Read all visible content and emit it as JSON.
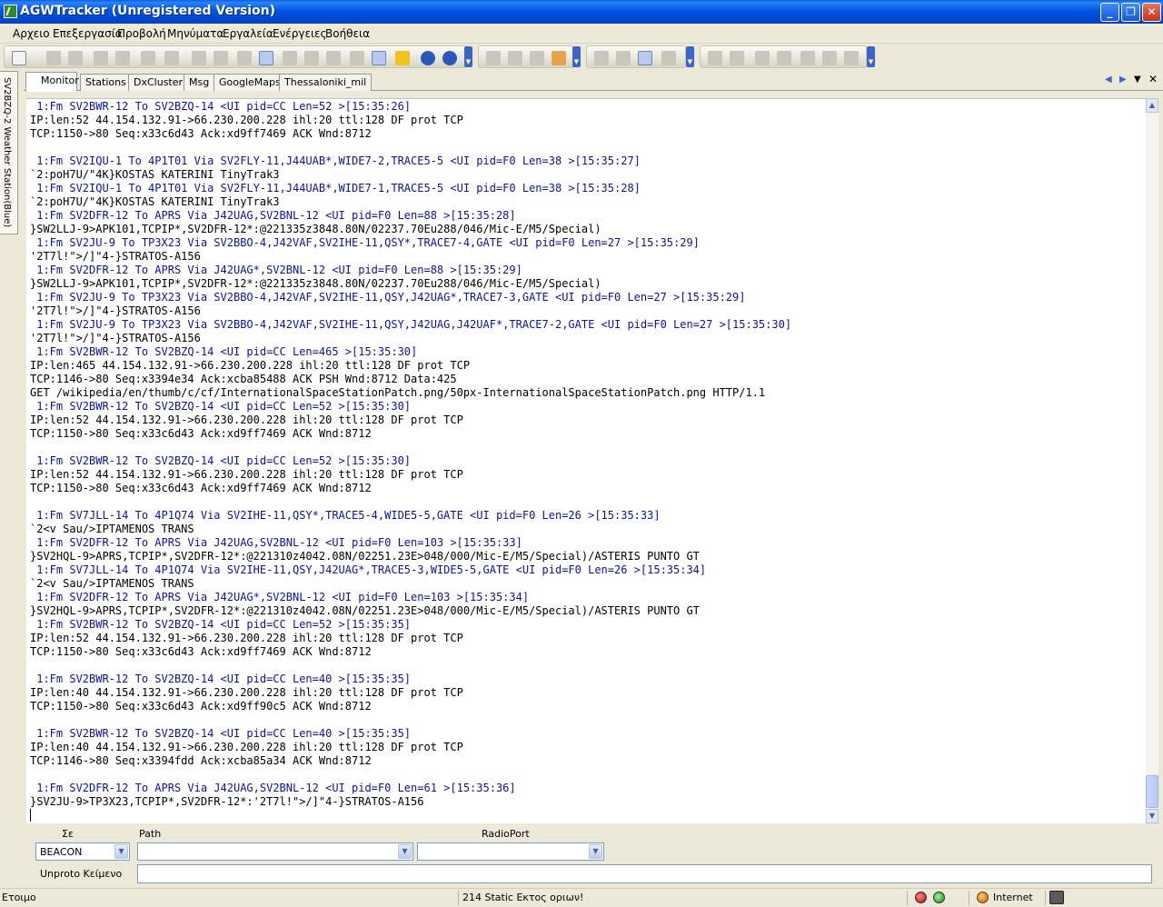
{
  "window": {
    "title": "AGWTracker (Unregistered Version)",
    "min_symbol": "_",
    "max_symbol": "❐",
    "close_symbol": "✕"
  },
  "menu": [
    "Αρχειο",
    "Επεξεργασία",
    "Προβολή",
    "Μηνύματα",
    "Εργαλεία",
    "Ενέργειες",
    "Βοήθεια"
  ],
  "side_tab": {
    "label": "SV2BZQ-2 Weather Station(Blue)"
  },
  "tabs": [
    "Monitor",
    "Stations",
    "DxCluster",
    "Msg",
    "GoogleMaps",
    "Thessaloniki_mil"
  ],
  "active_tab": "Monitor",
  "monitor_lines": [
    {
      "c": "blue",
      "t": " 1:Fm SV2BWR-12 To SV2BZQ-14 <UI pid=CC Len=52 >[15:35:26]"
    },
    {
      "c": "black",
      "t": "IP:len:52 44.154.132.91->66.230.200.228 ihl:20 ttl:128 DF prot TCP"
    },
    {
      "c": "black",
      "t": "TCP:1150->80 Seq:x33c6d43 Ack:xd9ff7469 ACK Wnd:8712"
    },
    {
      "c": "black",
      "t": ""
    },
    {
      "c": "blue",
      "t": " 1:Fm SV2IQU-1 To 4P1T01 Via SV2FLY-11,J44UAB*,WIDE7-2,TRACE5-5 <UI pid=F0 Len=38 >[15:35:27]"
    },
    {
      "c": "black",
      "t": "`2:poH7U/\"4K}KOSTAS KATERINI TinyTrak3"
    },
    {
      "c": "blue",
      "t": " 1:Fm SV2IQU-1 To 4P1T01 Via SV2FLY-11,J44UAB*,WIDE7-1,TRACE5-5 <UI pid=F0 Len=38 >[15:35:28]"
    },
    {
      "c": "black",
      "t": "`2:poH7U/\"4K}KOSTAS KATERINI TinyTrak3"
    },
    {
      "c": "blue",
      "t": " 1:Fm SV2DFR-12 To APRS Via J42UAG,SV2BNL-12 <UI pid=F0 Len=88 >[15:35:28]"
    },
    {
      "c": "black",
      "t": "}SW2LLJ-9>APK101,TCPIP*,SV2DFR-12*:@221335z3848.80N/02237.70Eu288/046/Mic-E/M5/Special)"
    },
    {
      "c": "blue",
      "t": " 1:Fm SV2JU-9 To TP3X23 Via SV2BBO-4,J42VAF,SV2IHE-11,QSY*,TRACE7-4,GATE <UI pid=F0 Len=27 >[15:35:29]"
    },
    {
      "c": "black",
      "t": "'2T7l!\">/]\"4-}STRATOS-A156"
    },
    {
      "c": "blue",
      "t": " 1:Fm SV2DFR-12 To APRS Via J42UAG*,SV2BNL-12 <UI pid=F0 Len=88 >[15:35:29]"
    },
    {
      "c": "black",
      "t": "}SW2LLJ-9>APK101,TCPIP*,SV2DFR-12*:@221335z3848.80N/02237.70Eu288/046/Mic-E/M5/Special)"
    },
    {
      "c": "blue",
      "t": " 1:Fm SV2JU-9 To TP3X23 Via SV2BBO-4,J42VAF,SV2IHE-11,QSY,J42UAG*,TRACE7-3,GATE <UI pid=F0 Len=27 >[15:35:29]"
    },
    {
      "c": "black",
      "t": "'2T7l!\">/]\"4-}STRATOS-A156"
    },
    {
      "c": "blue",
      "t": " 1:Fm SV2JU-9 To TP3X23 Via SV2BBO-4,J42VAF,SV2IHE-11,QSY,J42UAG,J42UAF*,TRACE7-2,GATE <UI pid=F0 Len=27 >[15:35:30]"
    },
    {
      "c": "black",
      "t": "'2T7l!\">/]\"4-}STRATOS-A156"
    },
    {
      "c": "blue",
      "t": " 1:Fm SV2BWR-12 To SV2BZQ-14 <UI pid=CC Len=465 >[15:35:30]"
    },
    {
      "c": "black",
      "t": "IP:len:465 44.154.132.91->66.230.200.228 ihl:20 ttl:128 DF prot TCP"
    },
    {
      "c": "black",
      "t": "TCP:1146->80 Seq:x3394e34 Ack:xcba85488 ACK PSH Wnd:8712 Data:425"
    },
    {
      "c": "black",
      "t": "GET /wikipedia/en/thumb/c/cf/InternationalSpaceStationPatch.png/50px-InternationalSpaceStationPatch.png HTTP/1.1"
    },
    {
      "c": "blue",
      "t": " 1:Fm SV2BWR-12 To SV2BZQ-14 <UI pid=CC Len=52 >[15:35:30]"
    },
    {
      "c": "black",
      "t": "IP:len:52 44.154.132.91->66.230.200.228 ihl:20 ttl:128 DF prot TCP"
    },
    {
      "c": "black",
      "t": "TCP:1150->80 Seq:x33c6d43 Ack:xd9ff7469 ACK Wnd:8712"
    },
    {
      "c": "black",
      "t": ""
    },
    {
      "c": "blue",
      "t": " 1:Fm SV2BWR-12 To SV2BZQ-14 <UI pid=CC Len=52 >[15:35:30]"
    },
    {
      "c": "black",
      "t": "IP:len:52 44.154.132.91->66.230.200.228 ihl:20 ttl:128 DF prot TCP"
    },
    {
      "c": "black",
      "t": "TCP:1150->80 Seq:x33c6d43 Ack:xd9ff7469 ACK Wnd:8712"
    },
    {
      "c": "black",
      "t": ""
    },
    {
      "c": "blue",
      "t": " 1:Fm SV7JLL-14 To 4P1Q74 Via SV2IHE-11,QSY*,TRACE5-4,WIDE5-5,GATE <UI pid=F0 Len=26 >[15:35:33]"
    },
    {
      "c": "black",
      "t": "`2<v Sau/>IPTAMENOS TRANS"
    },
    {
      "c": "blue",
      "t": " 1:Fm SV2DFR-12 To APRS Via J42UAG,SV2BNL-12 <UI pid=F0 Len=103 >[15:35:33]"
    },
    {
      "c": "black",
      "t": "}SV2HQL-9>APRS,TCPIP*,SV2DFR-12*:@221310z4042.08N/02251.23E>048/000/Mic-E/M5/Special)/ASTERIS PUNTO GT"
    },
    {
      "c": "blue",
      "t": " 1:Fm SV7JLL-14 To 4P1Q74 Via SV2IHE-11,QSY,J42UAG*,TRACE5-3,WIDE5-5,GATE <UI pid=F0 Len=26 >[15:35:34]"
    },
    {
      "c": "black",
      "t": "`2<v Sau/>IPTAMENOS TRANS"
    },
    {
      "c": "blue",
      "t": " 1:Fm SV2DFR-12 To APRS Via J42UAG*,SV2BNL-12 <UI pid=F0 Len=103 >[15:35:34]"
    },
    {
      "c": "black",
      "t": "}SV2HQL-9>APRS,TCPIP*,SV2DFR-12*:@221310z4042.08N/02251.23E>048/000/Mic-E/M5/Special)/ASTERIS PUNTO GT"
    },
    {
      "c": "blue",
      "t": " 1:Fm SV2BWR-12 To SV2BZQ-14 <UI pid=CC Len=52 >[15:35:35]"
    },
    {
      "c": "black",
      "t": "IP:len:52 44.154.132.91->66.230.200.228 ihl:20 ttl:128 DF prot TCP"
    },
    {
      "c": "black",
      "t": "TCP:1150->80 Seq:x33c6d43 Ack:xd9ff7469 ACK Wnd:8712"
    },
    {
      "c": "black",
      "t": ""
    },
    {
      "c": "blue",
      "t": " 1:Fm SV2BWR-12 To SV2BZQ-14 <UI pid=CC Len=40 >[15:35:35]"
    },
    {
      "c": "black",
      "t": "IP:len:40 44.154.132.91->66.230.200.228 ihl:20 ttl:128 DF prot TCP"
    },
    {
      "c": "black",
      "t": "TCP:1150->80 Seq:x33c6d43 Ack:xd9ff90c5 ACK Wnd:8712"
    },
    {
      "c": "black",
      "t": ""
    },
    {
      "c": "blue",
      "t": " 1:Fm SV2BWR-12 To SV2BZQ-14 <UI pid=CC Len=40 >[15:35:35]"
    },
    {
      "c": "black",
      "t": "IP:len:40 44.154.132.91->66.230.200.228 ihl:20 ttl:128 DF prot TCP"
    },
    {
      "c": "black",
      "t": "TCP:1146->80 Seq:x3394fdd Ack:xcba85a34 ACK Wnd:8712"
    },
    {
      "c": "black",
      "t": ""
    },
    {
      "c": "blue",
      "t": " 1:Fm SV2DFR-12 To APRS Via J42UAG,SV2BNL-12 <UI pid=F0 Len=61 >[15:35:36]"
    },
    {
      "c": "black",
      "t": "}SV2JU-9>TP3X23,TCPIP*,SV2DFR-12*:'2T7l!\">/]\"4-}STRATOS-A156"
    }
  ],
  "form": {
    "to_label": "Σε",
    "path_label": "Path",
    "radioport_label": "RadioPort",
    "to_value": "BEACON",
    "path_value": "",
    "radioport_value": "",
    "text_label": "Unproto Κείμενο",
    "text_value": ""
  },
  "status": {
    "left": "Ετοιμο",
    "middle": "214 Static Εκτος οριων!",
    "zone": "Internet"
  },
  "colors": {
    "title_bar": "#0055e5",
    "packet_header": "#0a12a8",
    "packet_body": "#000000",
    "active_tab": "#ffffff"
  },
  "icons": {
    "minimize": "minimize-icon",
    "maximize": "maximize-icon",
    "close": "close-icon",
    "internet_zone": "globe-icon",
    "status_green": "status-green-icon",
    "status_red": "status-red-icon",
    "network": "network-icon"
  }
}
